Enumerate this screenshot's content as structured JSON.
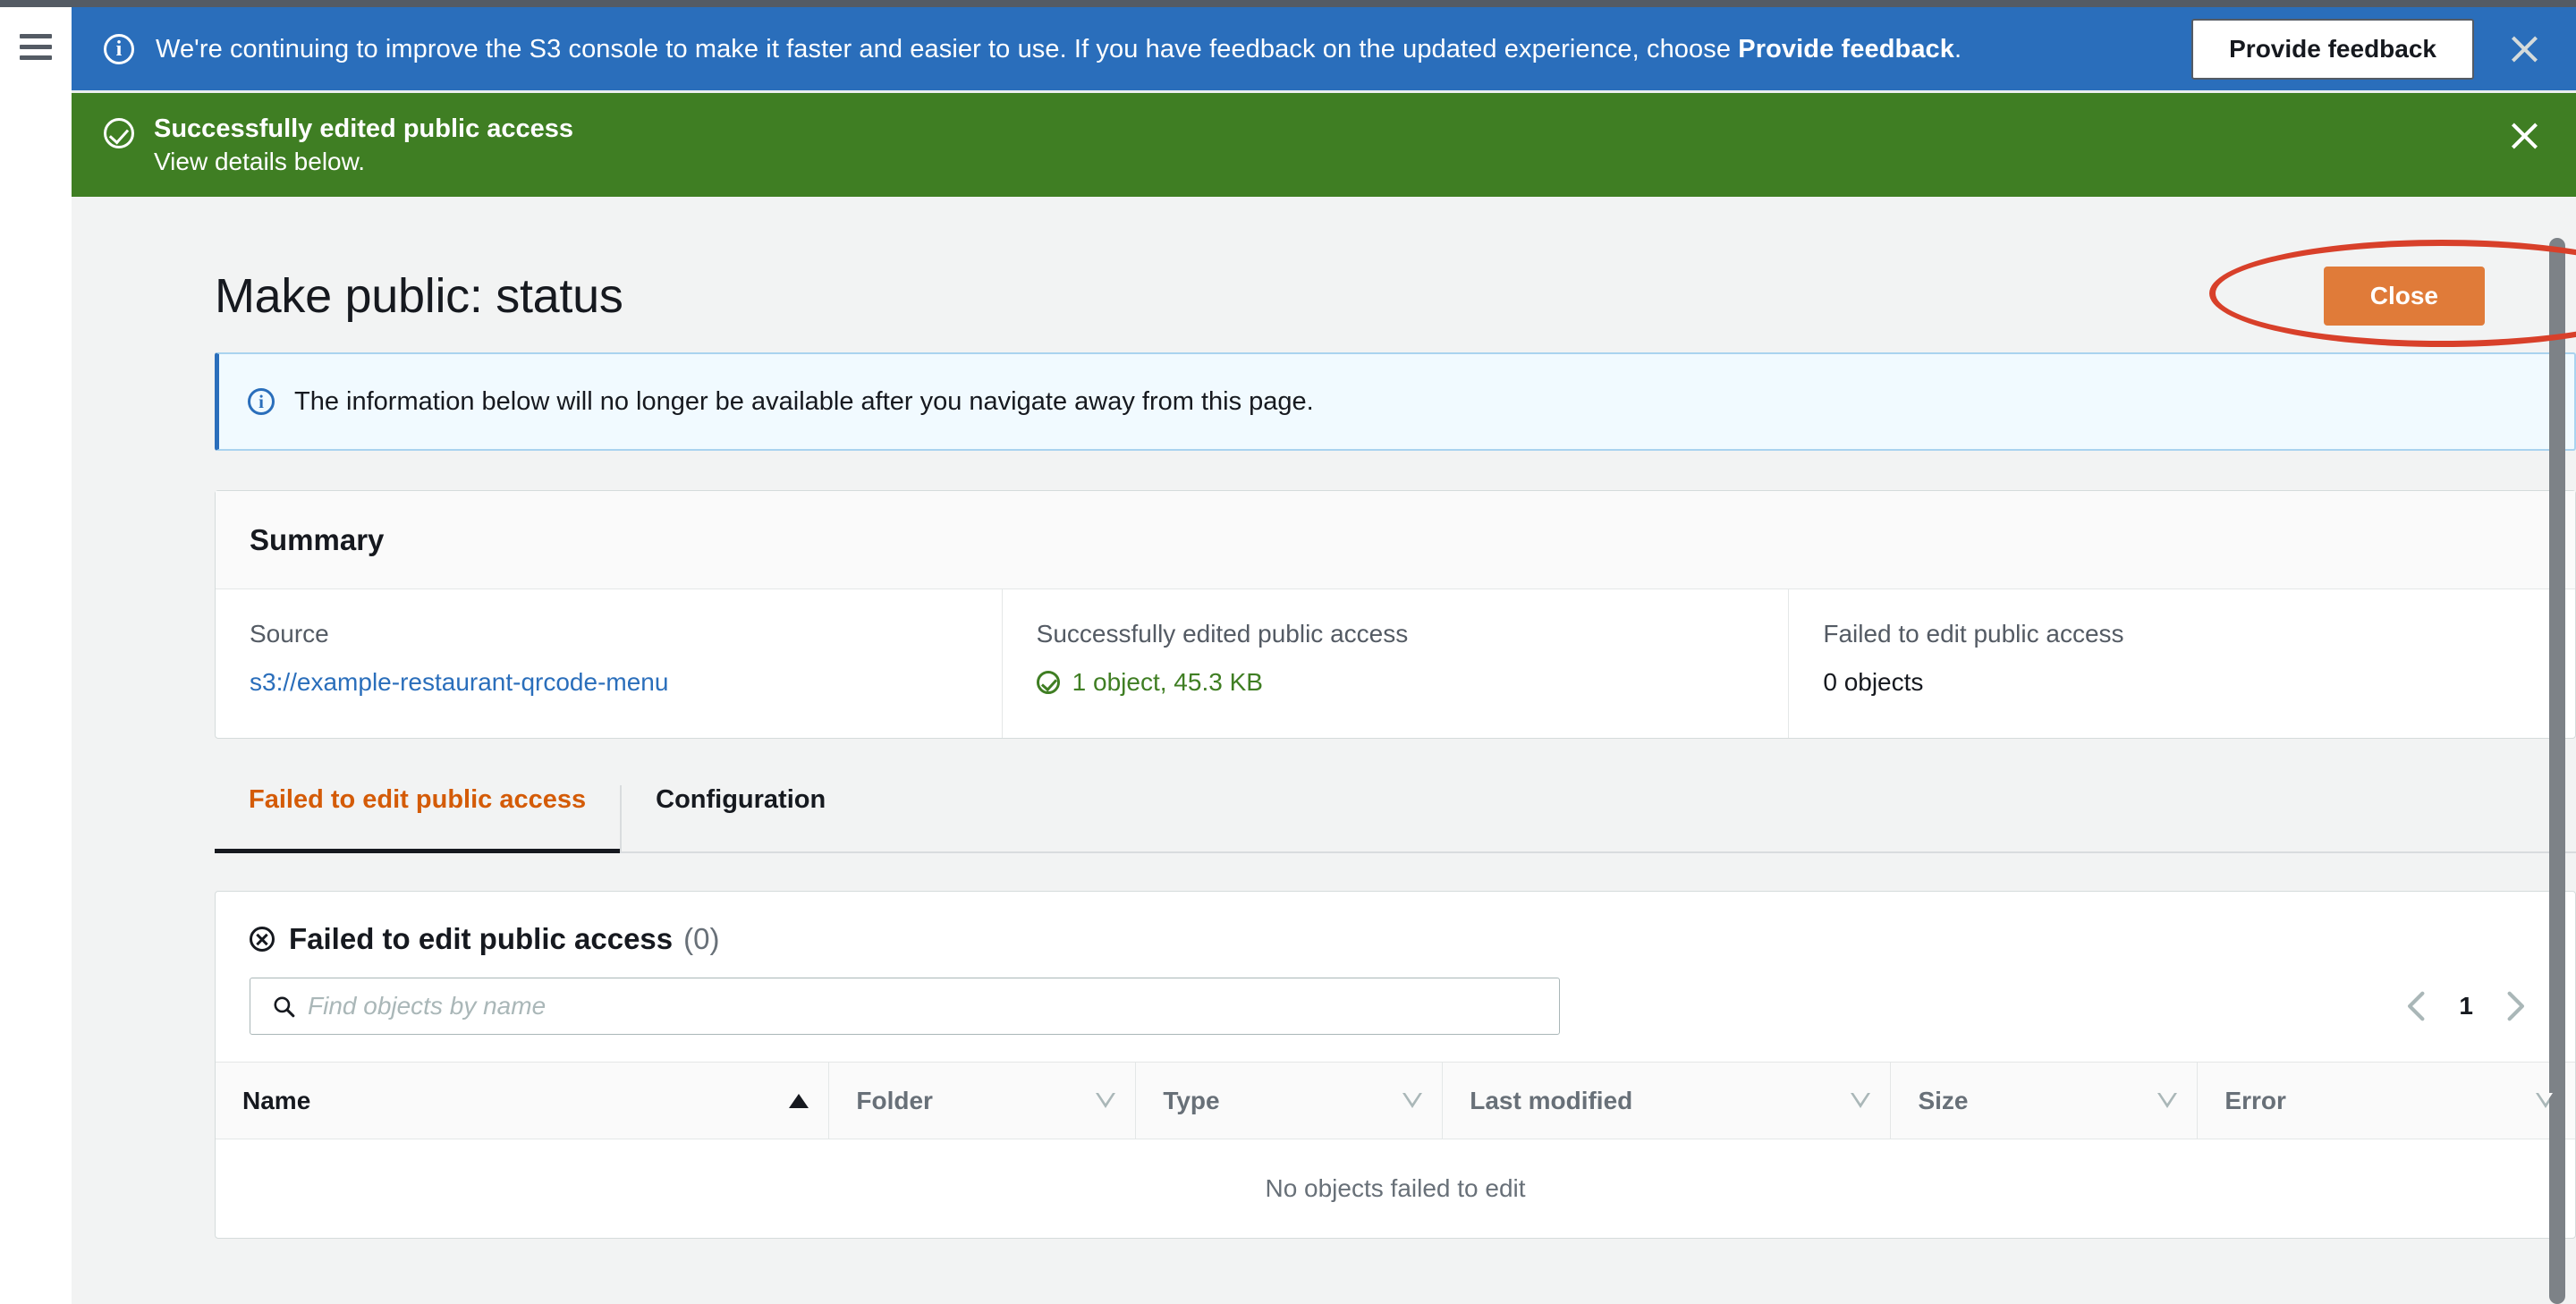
{
  "nav": {
    "menu_icon": "hamburger-menu-icon"
  },
  "feedback_banner": {
    "icon": "info-circle-icon",
    "text_before": "We're continuing to improve the S3 console to make it faster and easier to use. If you have feedback on the updated experience, choose ",
    "text_bold": "Provide feedback",
    "text_after": ".",
    "button_label": "Provide feedback",
    "close_icon": "close-icon",
    "bg_color": "#2a6ebb"
  },
  "success_banner": {
    "icon": "check-circle-icon",
    "title": "Successfully edited public access",
    "subtitle": "View details below.",
    "close_icon": "close-icon",
    "bg_color": "#3f7e23"
  },
  "page": {
    "title": "Make public: status",
    "close_button_label": "Close",
    "close_button_color": "#e07b39",
    "annotation_color": "#d8402a"
  },
  "info_alert": {
    "icon": "info-circle-icon",
    "text": "The information below will no longer be available after you navigate away from this page.",
    "bg_color": "#f1faff",
    "accent_color": "#2a6ebb"
  },
  "summary": {
    "heading": "Summary",
    "columns": [
      {
        "label": "Source",
        "value": "s3://example-restaurant-qrcode-menu",
        "kind": "link"
      },
      {
        "label": "Successfully edited public access",
        "value": "1 object, 45.3 KB",
        "kind": "success"
      },
      {
        "label": "Failed to edit public access",
        "value": "0 objects",
        "kind": "plain"
      }
    ]
  },
  "tabs": [
    {
      "label": "Failed to edit public access",
      "active": true
    },
    {
      "label": "Configuration",
      "active": false
    }
  ],
  "table_panel": {
    "icon": "x-circle-icon",
    "title": "Failed to edit public access",
    "count": "(0)",
    "search": {
      "icon": "search-icon",
      "placeholder": "Find objects by name",
      "value": ""
    },
    "pagination": {
      "prev_icon": "chevron-left-icon",
      "page": "1",
      "next_icon": "chevron-right-icon"
    },
    "columns": [
      {
        "label": "Name",
        "sort": "asc",
        "active": true
      },
      {
        "label": "Folder",
        "sort": "desc",
        "active": false
      },
      {
        "label": "Type",
        "sort": "desc",
        "active": false
      },
      {
        "label": "Last modified",
        "sort": "desc",
        "active": false
      },
      {
        "label": "Size",
        "sort": "desc",
        "active": false
      },
      {
        "label": "Error",
        "sort": "desc",
        "active": false
      }
    ],
    "rows": [],
    "empty_message": "No objects failed to edit"
  }
}
